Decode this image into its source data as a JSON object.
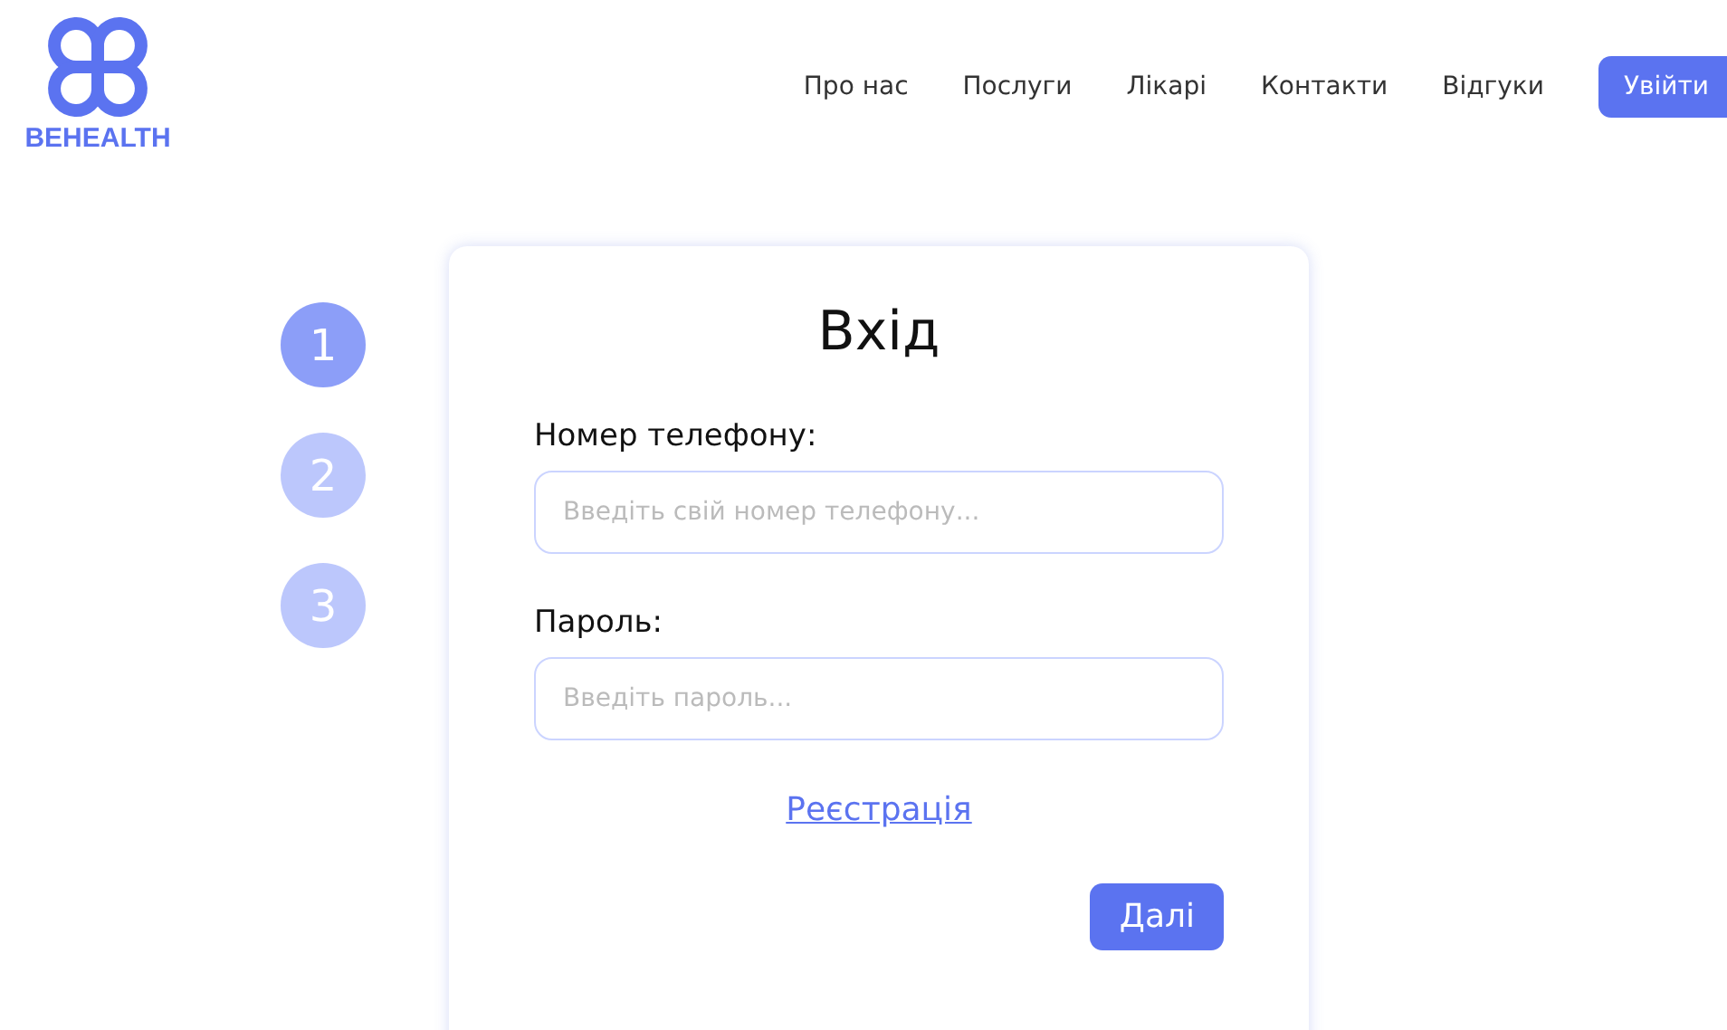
{
  "logo": {
    "text": "BEHEALTH"
  },
  "nav": {
    "items": [
      "Про нас",
      "Послуги",
      "Лікарі",
      "Контакти",
      "Відгуки"
    ],
    "login_button": "Увійти"
  },
  "steps": [
    {
      "label": "1",
      "selected": true
    },
    {
      "label": "2",
      "selected": false
    },
    {
      "label": "3",
      "selected": false
    }
  ],
  "form": {
    "title": "Вхід",
    "fields": [
      {
        "label": "Номер телефону:",
        "placeholder": "Введіть свій номер телефону..."
      },
      {
        "label": "Пароль:",
        "placeholder": "Введіть пароль..."
      }
    ],
    "register_link": "Реєстрація",
    "next_button": "Далі"
  }
}
